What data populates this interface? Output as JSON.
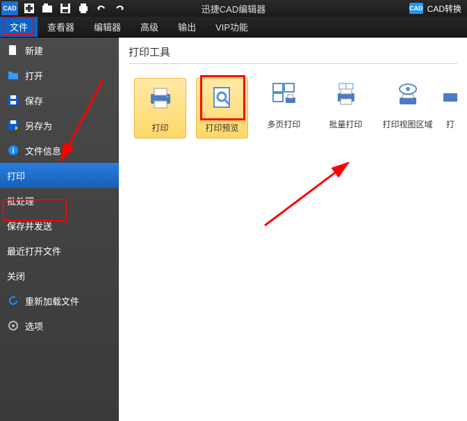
{
  "titlebar": {
    "app_icon": "CAD",
    "title": "迅捷CAD编辑器",
    "convert_icon": "CAD",
    "convert_label": "CAD转换"
  },
  "menubar": {
    "items": [
      {
        "label": "文件",
        "active": true
      },
      {
        "label": "查看器",
        "active": false
      },
      {
        "label": "编辑器",
        "active": false
      },
      {
        "label": "高级",
        "active": false
      },
      {
        "label": "输出",
        "active": false
      },
      {
        "label": "VIP功能",
        "active": false
      }
    ]
  },
  "sidebar": {
    "items": [
      {
        "label": "新建",
        "icon": "new-icon",
        "selected": false
      },
      {
        "label": "打开",
        "icon": "open-icon",
        "selected": false
      },
      {
        "label": "保存",
        "icon": "save-icon",
        "selected": false
      },
      {
        "label": "另存为",
        "icon": "saveas-icon",
        "selected": false
      },
      {
        "label": "文件信息",
        "icon": "info-icon",
        "selected": false
      },
      {
        "label": "打印",
        "icon": "",
        "selected": true
      },
      {
        "label": "批处理",
        "icon": "",
        "selected": false
      },
      {
        "label": "保存并发送",
        "icon": "",
        "selected": false
      },
      {
        "label": "最近打开文件",
        "icon": "",
        "selected": false
      },
      {
        "label": "关闭",
        "icon": "",
        "selected": false
      },
      {
        "label": "重新加载文件",
        "icon": "reload-icon",
        "selected": false
      },
      {
        "label": "选项",
        "icon": "options-icon",
        "selected": false
      }
    ]
  },
  "content": {
    "title": "打印工具",
    "tools": [
      {
        "label": "打印",
        "highlight": true
      },
      {
        "label": "打印预览",
        "highlight": true
      },
      {
        "label": "多页打印",
        "highlight": false
      },
      {
        "label": "批量打印",
        "highlight": false
      },
      {
        "label": "打印视图区域",
        "highlight": false
      },
      {
        "label": "打",
        "highlight": false
      }
    ]
  }
}
